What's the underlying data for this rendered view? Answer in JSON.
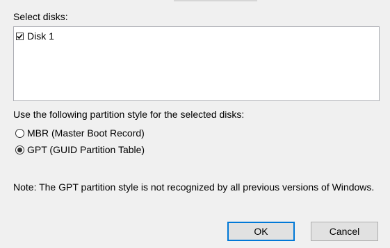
{
  "dialog": {
    "select_disks_label": "Select disks:",
    "disks": [
      {
        "label": "Disk 1",
        "checked": true
      }
    ],
    "partition_style_label": "Use the following partition style for the selected disks:",
    "partition_options": [
      {
        "label": "MBR (Master Boot Record)",
        "selected": false
      },
      {
        "label": "GPT (GUID Partition Table)",
        "selected": true
      }
    ],
    "note": "Note: The GPT partition style is not recognized by all previous versions of Windows.",
    "ok_label": "OK",
    "cancel_label": "Cancel"
  },
  "colors": {
    "background": "#f0f0f0",
    "list_border": "#abadb3",
    "default_button_border": "#0078d7",
    "button_fill": "#e1e1e1"
  }
}
